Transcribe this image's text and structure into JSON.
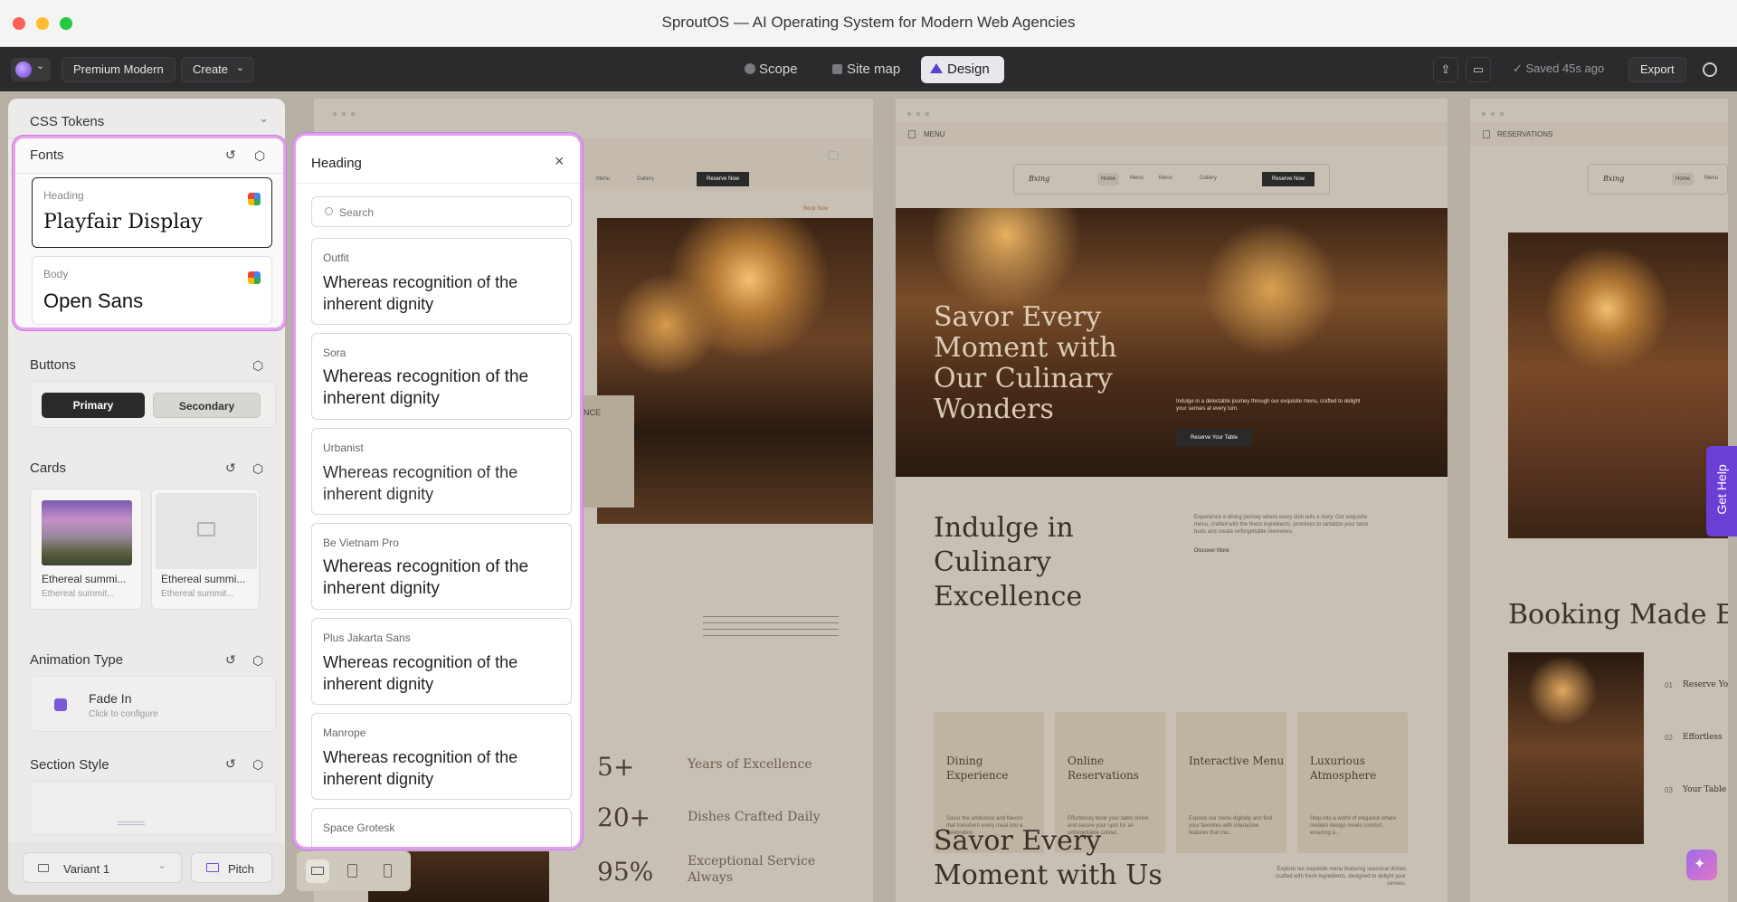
{
  "window": {
    "title": "SproutOS — AI Operating System for Modern Web Agencies"
  },
  "toolbar": {
    "workspace": "Premium Modern",
    "create": "Create",
    "tabs": [
      {
        "label": "Scope"
      },
      {
        "label": "Site map"
      },
      {
        "label": "Design"
      }
    ],
    "active_tab": "Design",
    "saved": "Saved 45s ago",
    "export": "Export"
  },
  "left": {
    "css_tokens": "CSS Tokens",
    "fonts": {
      "title": "Fonts",
      "heading_label": "Heading",
      "heading_font": "Playfair Display",
      "body_label": "Body",
      "body_font": "Open Sans"
    },
    "buttons": {
      "title": "Buttons",
      "primary": "Primary",
      "secondary": "Secondary"
    },
    "cards": {
      "title": "Cards",
      "items": [
        {
          "title": "Ethereal summi...",
          "sub": "Ethereal summit..."
        },
        {
          "title": "Ethereal summi...",
          "sub": "Ethereal summit..."
        }
      ]
    },
    "animation": {
      "title": "Animation Type",
      "name": "Fade In",
      "hint": "Click to configure"
    },
    "section_style": {
      "title": "Section Style"
    },
    "footer": {
      "variant": "Variant 1",
      "pitch": "Pitch"
    }
  },
  "heading_panel": {
    "title": "Heading",
    "search_placeholder": "Search",
    "sample": "Whereas recognition of the inherent dignity",
    "fonts": [
      "Outfit",
      "Sora",
      "Urbanist",
      "Be Vietnam Pro",
      "Plus Jakarta Sans",
      "Manrope",
      "Space Grotesk"
    ]
  },
  "site1": {
    "nav": [
      "Menu",
      "Gallery"
    ],
    "reserve": "Reserve Now",
    "book": "Book Now",
    "partial": "NCE",
    "stats": [
      {
        "num": "5+",
        "label": "Years of Excellence"
      },
      {
        "num": "20+",
        "label": "Dishes Crafted Daily"
      },
      {
        "num": "95%",
        "label": "Exceptional Service Always"
      }
    ]
  },
  "site2": {
    "tab": "MENU",
    "logo": "Bxing",
    "nav": [
      "Home",
      "Menu",
      "Menu",
      "Gallery"
    ],
    "reserve": "Reserve Now",
    "hero_title": "Savor Every Moment with Our Culinary Wonders",
    "hero_text": "Indulge in a delectable journey through our exquisite menu, crafted to delight your senses at every turn.",
    "hero_btn": "Reserve Your Table",
    "indulge_title": "Indulge in Culinary Excellence",
    "indulge_text": "Experience a dining journey where every dish tells a story. Our exquisite menu, crafted with the finest ingredients, promises to tantalize your taste buds and create unforgettable memories.",
    "discover": "Discover More",
    "features": [
      {
        "title": "Dining Experience",
        "text": "Savor the ambiance and flavors that transform every meal into a celebration."
      },
      {
        "title": "Online Reservations",
        "text": "Effortlessly book your table online and secure your spot for an unforgettable culinar..."
      },
      {
        "title": "Interactive Menu",
        "text": "Explore our menu digitally and find your favorites with interactive features that ma..."
      },
      {
        "title": "Luxurious Atmosphere",
        "text": "Step into a world of elegance where modern design meets comfort, ensuring a..."
      }
    ],
    "savor_title": "Savor Every Moment with Us",
    "savor_text": "Explore our exquisite menu featuring seasonal dishes crafted with fresh ingredients, designed to delight your senses."
  },
  "site3": {
    "tab": "RESERVATIONS",
    "logo": "Bxing",
    "nav": [
      "Home",
      "Menu"
    ],
    "booking_title": "Booking Made Eas",
    "steps": [
      {
        "n": "01",
        "t": "Reserve Yo"
      },
      {
        "n": "02",
        "t": "Effortless"
      },
      {
        "n": "03",
        "t": "Your Table"
      }
    ]
  },
  "help": "Get Help",
  "colors": {
    "accent": "#6b3fd6",
    "highlight": "#e59fe8",
    "dark_button": "#2a2a2a"
  }
}
